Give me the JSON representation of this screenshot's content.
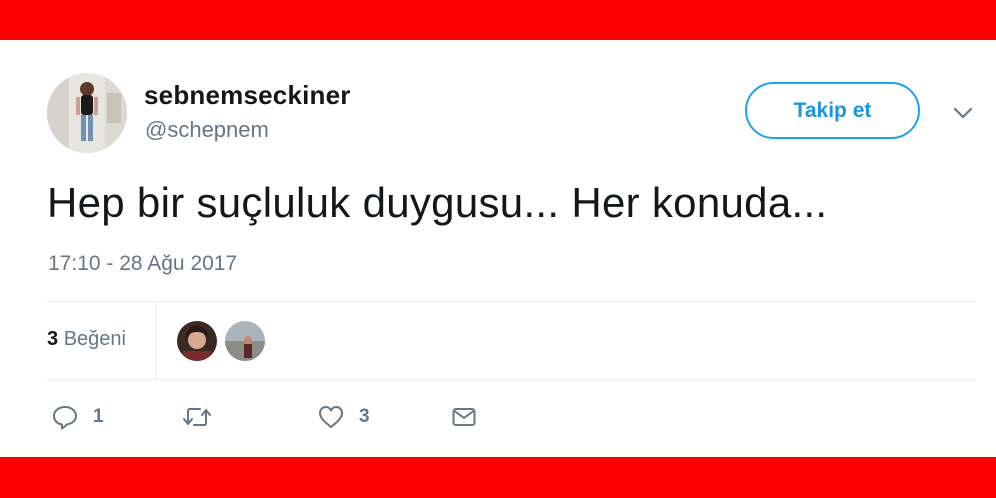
{
  "colors": {
    "frame_red": "#ff0000",
    "text_primary": "#14171a",
    "text_secondary": "#657786",
    "accent_blue": "#1da1f2",
    "divider": "#e6ecf0"
  },
  "header": {
    "display_name": "sebnemseckiner",
    "handle": "@schepnem",
    "follow_label": "Takip et",
    "menu_icon": "chevron-down-icon"
  },
  "tweet": {
    "text": "Hep bir suçluluk duygusu... Her konuda...",
    "timestamp": "17:10 - 28 Ağu 2017"
  },
  "stats": {
    "likes_count": "3",
    "likes_label": "Beğeni",
    "liker_avatars": [
      "liker-avatar-1",
      "liker-avatar-2"
    ]
  },
  "actions": {
    "reply": {
      "icon": "reply-icon",
      "count": "1"
    },
    "retweet": {
      "icon": "retweet-icon",
      "count": ""
    },
    "like": {
      "icon": "heart-icon",
      "count": "3"
    },
    "dm": {
      "icon": "envelope-icon"
    }
  }
}
